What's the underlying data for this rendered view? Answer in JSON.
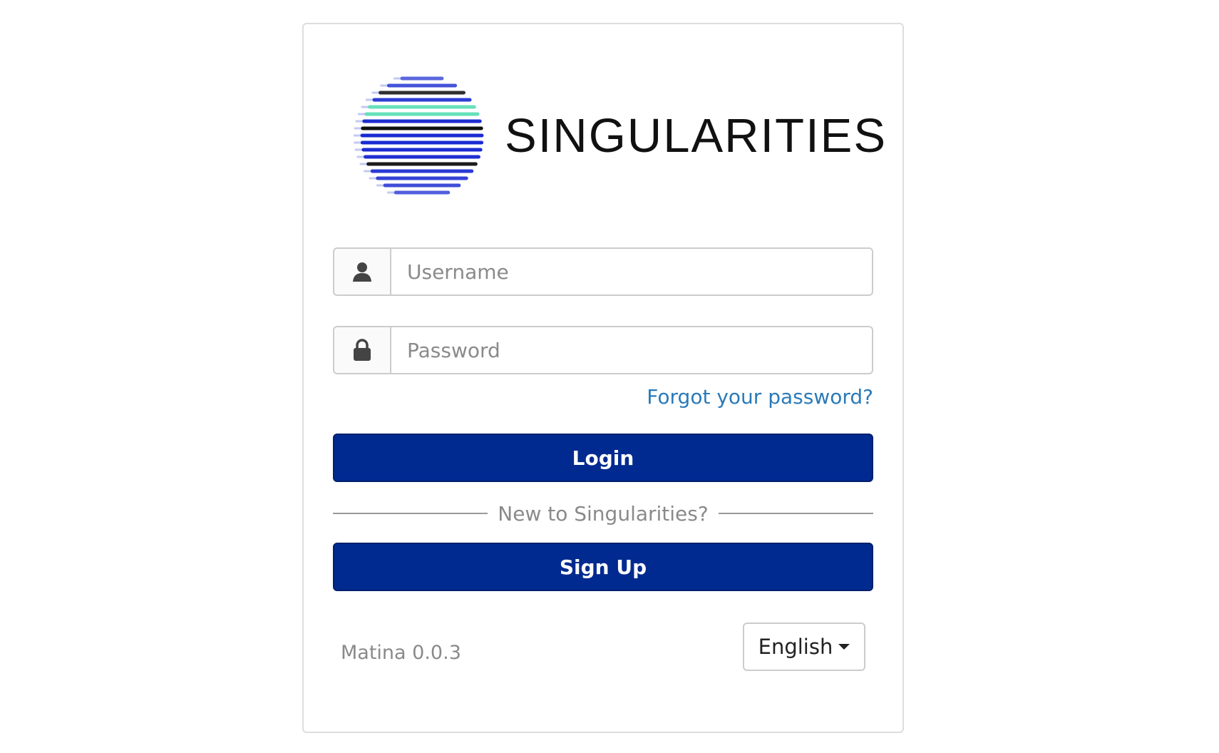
{
  "logo": {
    "wordmark": "SINGULARITIES",
    "colors": {
      "primary": "#1a2bd1",
      "accent": "#5fe0b8",
      "dark": "#111111"
    }
  },
  "form": {
    "username": {
      "placeholder": "Username",
      "value": "",
      "icon": "user-icon"
    },
    "password": {
      "placeholder": "Password",
      "value": "",
      "icon": "lock-icon"
    },
    "forgot_link": "Forgot your password?",
    "login_label": "Login",
    "divider_text": "New to Singularities?",
    "signup_label": "Sign Up"
  },
  "footer": {
    "version": "Matina 0.0.3",
    "language": "English"
  },
  "colors": {
    "button_bg": "#002a8f",
    "link": "#2a7ab8",
    "muted_text": "#8a8a8a",
    "border": "#cccccc"
  }
}
